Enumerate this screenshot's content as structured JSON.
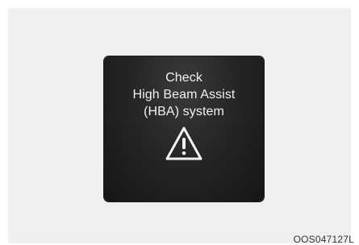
{
  "message": {
    "line1": "Check",
    "line2": "High Beam Assist",
    "line3": "(HBA) system",
    "icon": "warning-triangle-icon"
  },
  "figure_code": "OOS047127L",
  "colors": {
    "page_background": "#ffffff",
    "panel_background": "#efefef",
    "display_background": "#262626",
    "display_text": "#f2f2f2"
  }
}
